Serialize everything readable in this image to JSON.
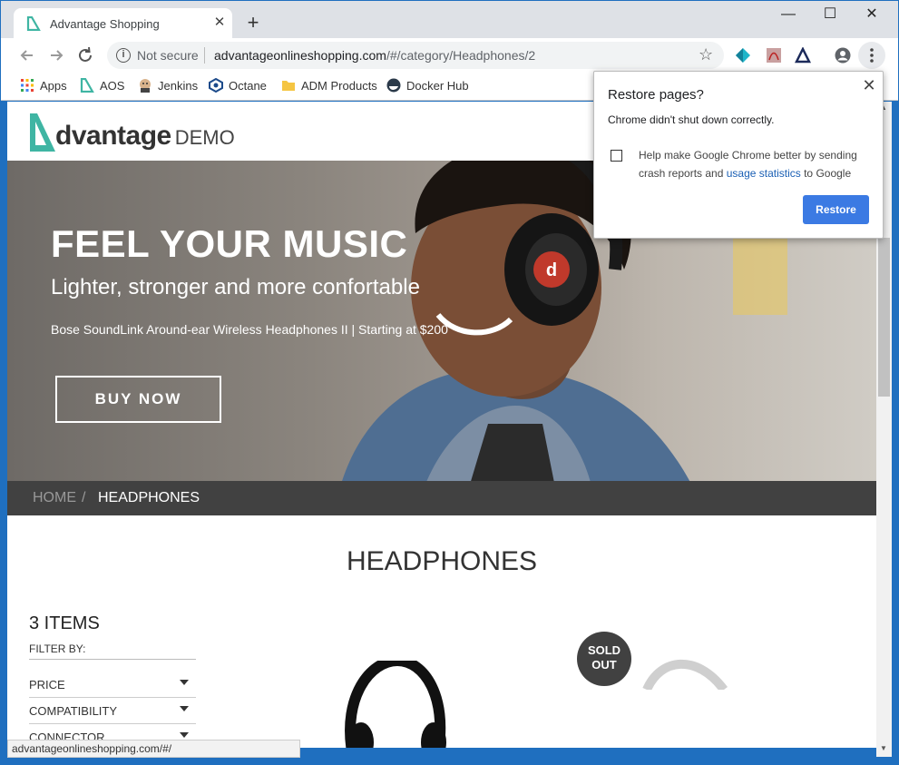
{
  "browser": {
    "tab_title": "Advantage Shopping",
    "tab_close": "✕",
    "new_tab": "+",
    "window_minimize": "—",
    "window_maximize": "☐",
    "window_close": "✕",
    "omnibox": {
      "security_label": "Not secure",
      "url_host": "advantageonlineshopping.com",
      "url_path": "/#/category/Headphones/2"
    },
    "bookmarks": [
      {
        "label": "Apps",
        "icon": "apps-grid-icon"
      },
      {
        "label": "AOS",
        "icon": "aos-icon"
      },
      {
        "label": "Jenkins",
        "icon": "jenkins-icon"
      },
      {
        "label": "Octane",
        "icon": "octane-icon"
      },
      {
        "label": "ADM Products",
        "icon": "folder-icon"
      },
      {
        "label": "Docker Hub",
        "icon": "docker-icon"
      }
    ],
    "status_url": "advantageonlineshopping.com/#/"
  },
  "site": {
    "logo_word": "dvantage",
    "logo_demo": "DEMO",
    "hero": {
      "headline": "FEEL YOUR MUSIC",
      "subheadline": "Lighter, stronger and more confortable",
      "tagline": "Bose SoundLink Around-ear Wireless Headphones II | Starting at $200",
      "button": "BUY NOW"
    },
    "breadcrumb": {
      "home": "HOME",
      "separator": "/",
      "current": "HEADPHONES"
    },
    "category_title": "HEADPHONES",
    "items_count": "3 ITEMS",
    "filter_by": "FILTER BY:",
    "filters": [
      "PRICE",
      "COMPATIBILITY",
      "CONNECTOR"
    ],
    "sold_out_line1": "SOLD",
    "sold_out_line2": "OUT"
  },
  "popup": {
    "title": "Restore pages?",
    "message": "Chrome didn't shut down correctly.",
    "checkbox_text_before": "Help make Google Chrome better by sending crash reports and ",
    "checkbox_link": "usage statistics",
    "checkbox_text_after": " to Google",
    "restore_button": "Restore",
    "close": "✕"
  },
  "colors": {
    "accent_teal": "#3fb5a3",
    "chrome_blue": "#3b7ae3",
    "breadcrumb_bg": "#414141"
  }
}
